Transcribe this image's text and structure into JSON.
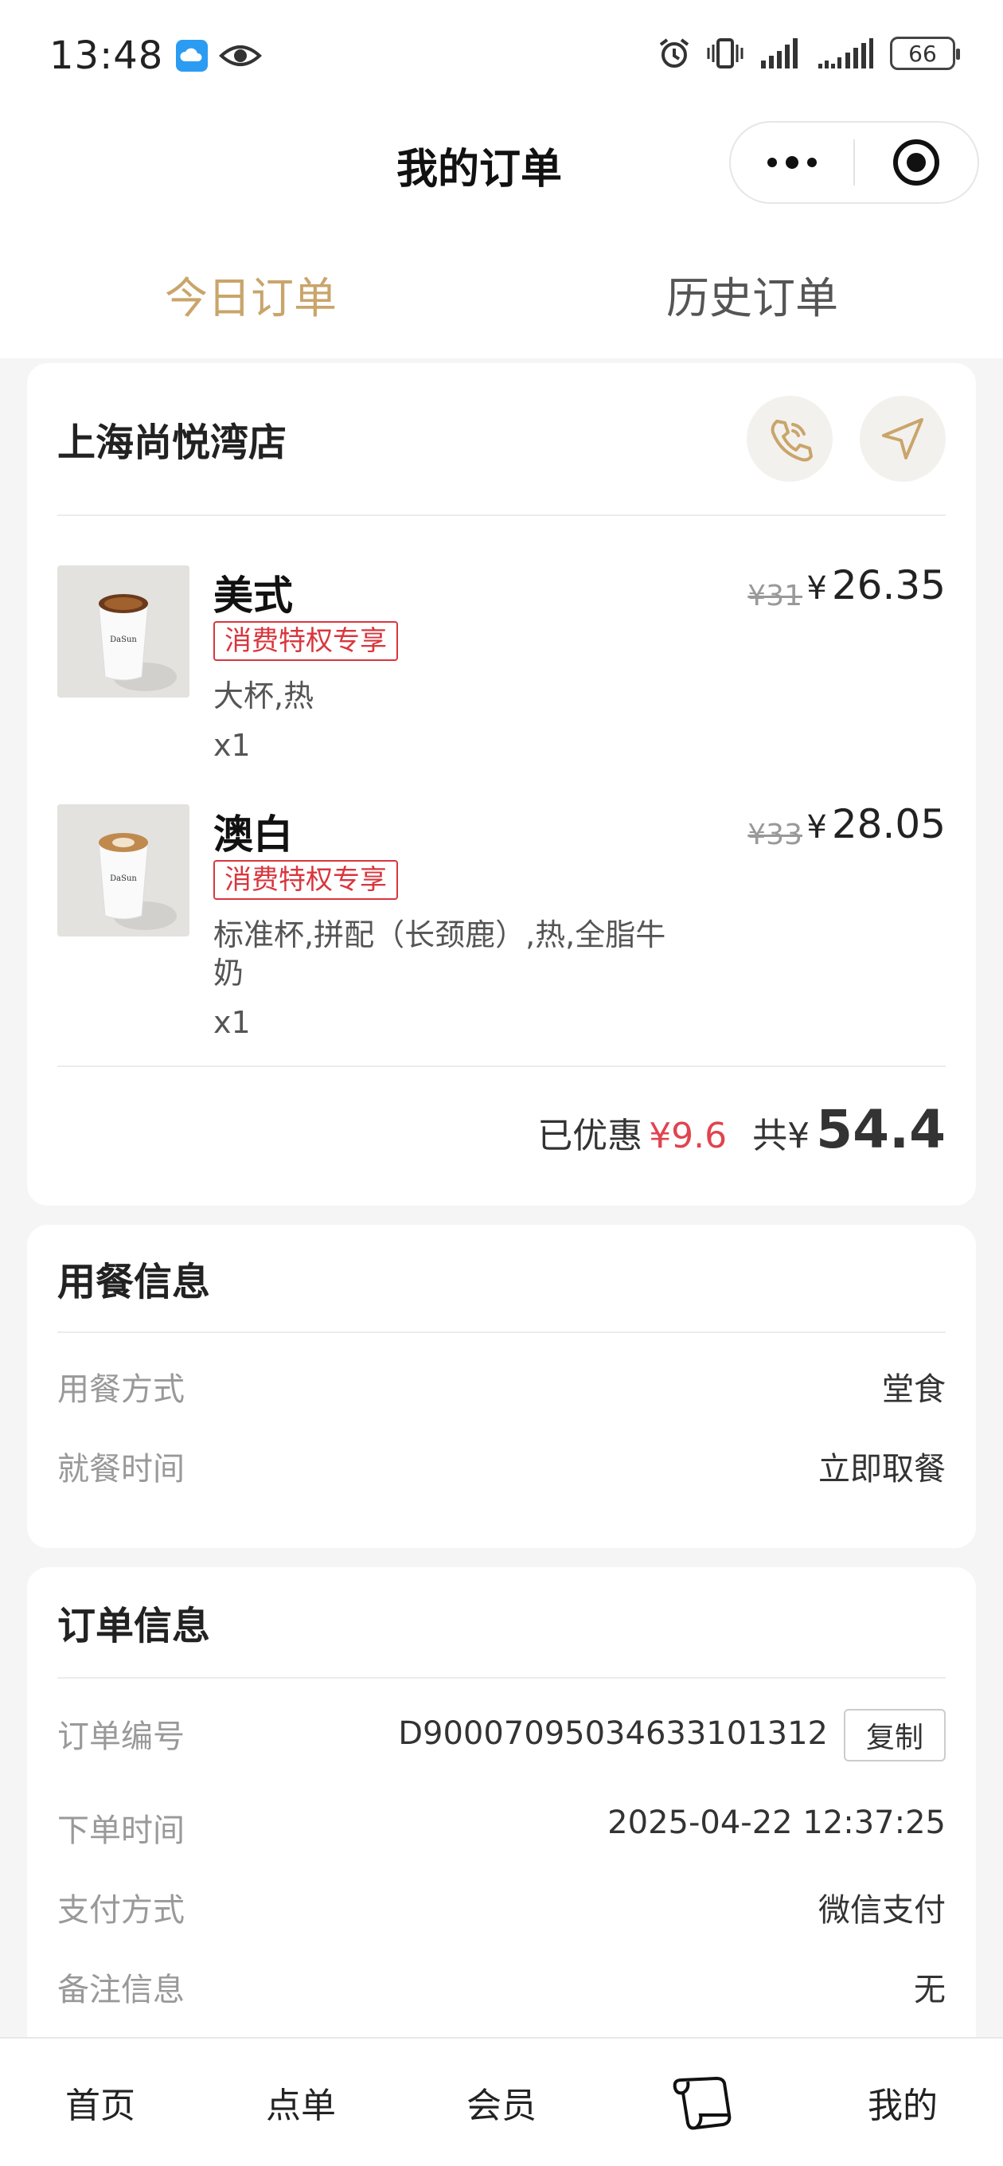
{
  "status_bar": {
    "time": "13:48",
    "battery": "66"
  },
  "nav": {
    "title": "我的订单"
  },
  "tabs": [
    {
      "label": "今日订单",
      "active": true
    },
    {
      "label": "历史订单",
      "active": false
    }
  ],
  "order": {
    "store_name": "上海尚悦湾店",
    "items": [
      {
        "name": "美式",
        "tag": "消费特权专享",
        "spec": "大杯,热",
        "qty": "x1",
        "original_price": "¥31",
        "price_symbol": "¥",
        "price": "26.35"
      },
      {
        "name": "澳白",
        "tag": "消费特权专享",
        "spec": "标准杯,拼配（长颈鹿）,热,全脂牛奶",
        "qty": "x1",
        "original_price": "¥33",
        "price_symbol": "¥",
        "price": "28.05"
      }
    ],
    "discount_label": "已优惠",
    "discount_value": "¥9.6",
    "total_label": "共¥",
    "total_value": "54.4"
  },
  "dining_info": {
    "title": "用餐信息",
    "rows": [
      {
        "label": "用餐方式",
        "value": "堂食"
      },
      {
        "label": "就餐时间",
        "value": "立即取餐"
      }
    ]
  },
  "order_info": {
    "title": "订单信息",
    "order_no_label": "订单编号",
    "order_no": "D90007095034633101312",
    "copy_label": "复制",
    "rows": [
      {
        "label": "下单时间",
        "value": "2025-04-22 12:37:25"
      },
      {
        "label": "支付方式",
        "value": "微信支付"
      },
      {
        "label": "备注信息",
        "value": "无"
      }
    ]
  },
  "bottom_nav": [
    {
      "label": "首页"
    },
    {
      "label": "点单"
    },
    {
      "label": "会员"
    },
    {
      "label": "",
      "icon": "scroll-icon"
    },
    {
      "label": "我的"
    }
  ],
  "colors": {
    "accent": "#c9a56b",
    "discount": "#e0444f",
    "tag": "#d9363e"
  }
}
